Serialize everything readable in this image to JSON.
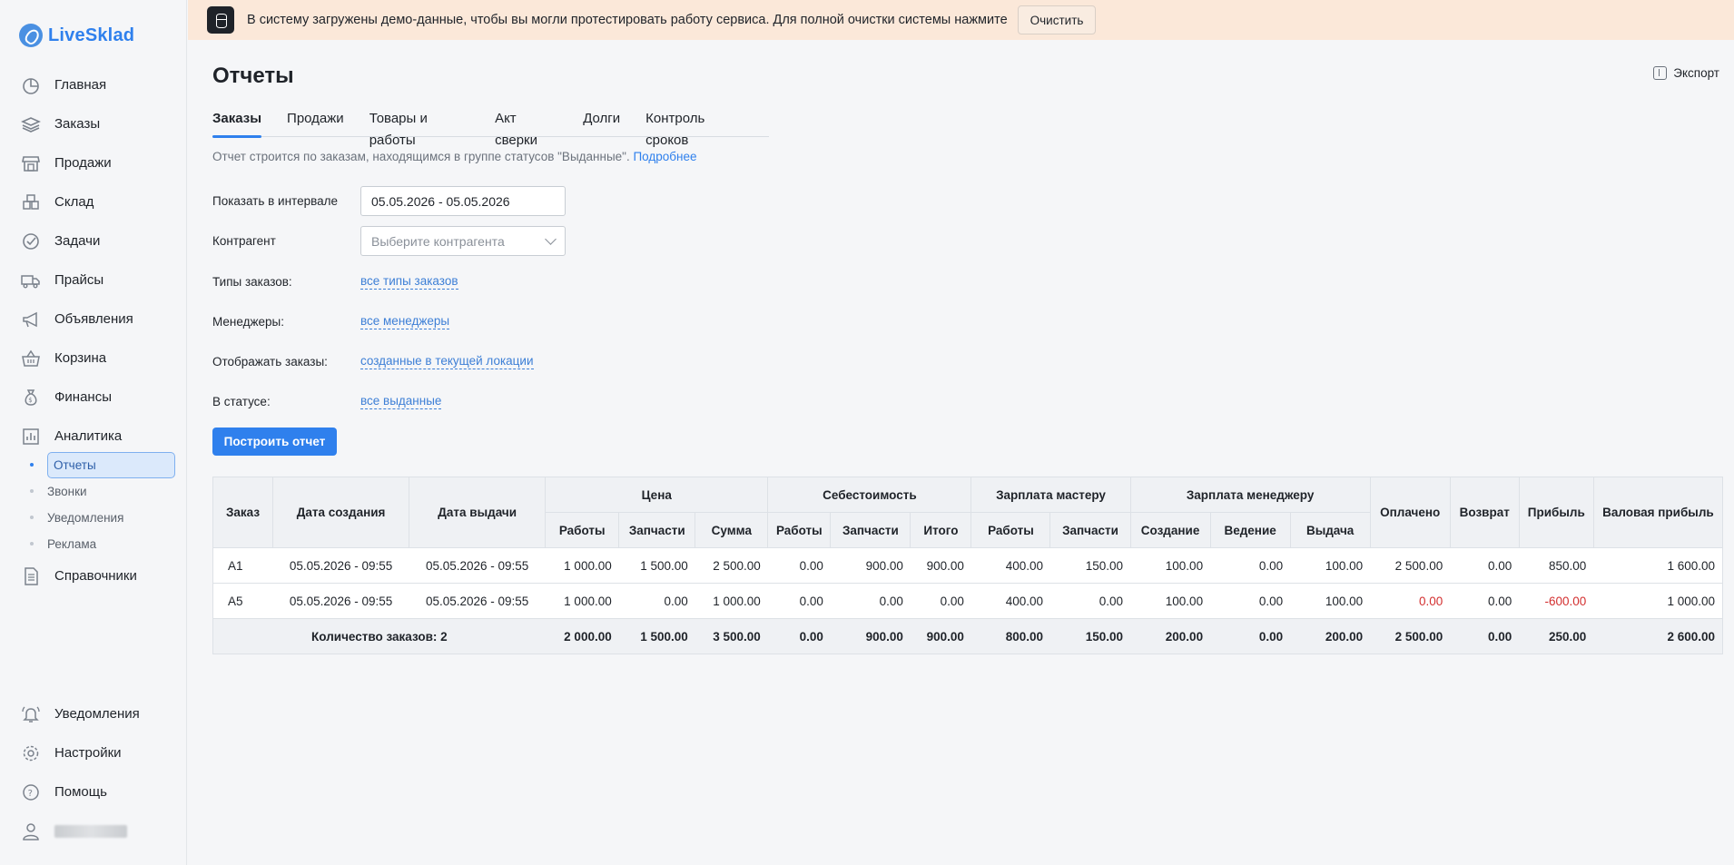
{
  "app": {
    "name": "LiveSklad"
  },
  "sidebar": {
    "items": [
      {
        "label": "Главная",
        "icon": "pie-chart-icon"
      },
      {
        "label": "Заказы",
        "icon": "layers-icon"
      },
      {
        "label": "Продажи",
        "icon": "store-icon"
      },
      {
        "label": "Склад",
        "icon": "boxes-icon"
      },
      {
        "label": "Задачи",
        "icon": "check-circle-icon"
      },
      {
        "label": "Прайсы",
        "icon": "truck-icon"
      },
      {
        "label": "Объявления",
        "icon": "megaphone-icon"
      },
      {
        "label": "Корзина",
        "icon": "basket-icon"
      },
      {
        "label": "Финансы",
        "icon": "money-bag-icon"
      },
      {
        "label": "Аналитика",
        "icon": "bar-chart-icon"
      }
    ],
    "sub_items": [
      {
        "label": "Отчеты",
        "active": true
      },
      {
        "label": "Звонки"
      },
      {
        "label": "Уведомления"
      },
      {
        "label": "Реклама"
      }
    ],
    "reference": {
      "label": "Справочники",
      "icon": "document-icon"
    },
    "bottom": [
      {
        "label": "Уведомления",
        "icon": "bell-icon"
      },
      {
        "label": "Настройки",
        "icon": "gear-icon"
      },
      {
        "label": "Помощь",
        "icon": "help-icon"
      }
    ]
  },
  "banner": {
    "text": "В систему загружены демо-данные, чтобы вы могли протестировать работу сервиса. Для полной очистки системы нажмите",
    "button": "Очистить"
  },
  "page": {
    "title": "Отчеты",
    "export": "Экспорт",
    "tabs": [
      "Заказы",
      "Продажи",
      "Товары и работы",
      "Акт сверки",
      "Долги",
      "Контроль сроков"
    ],
    "note": "Отчет строится по заказам, находящимся в группе статусов \"Выданные\".",
    "note_link": "Подробнее",
    "filters": {
      "interval_label": "Показать в интервале",
      "interval_value": "05.05.2026 - 05.05.2026",
      "counterparty_label": "Контрагент",
      "counterparty_placeholder": "Выберите контрагента",
      "types_label": "Типы заказов:",
      "types_value": "все типы заказов",
      "managers_label": "Менеджеры:",
      "managers_value": "все менеджеры",
      "show_label": "Отображать заказы:",
      "show_value": "созданные в текущей локации",
      "status_label": "В статусе:",
      "status_value": "все выданные"
    },
    "build_button": "Построить отчет"
  },
  "table": {
    "headers": {
      "order": "Заказ",
      "created": "Дата создания",
      "issued": "Дата выдачи",
      "price": "Цена",
      "cost": "Себестоимость",
      "master_pay": "Зарплата мастеру",
      "manager_pay": "Зарплата менеджеру",
      "paid": "Оплачено",
      "refund": "Возврат",
      "profit": "Прибыль",
      "gross": "Валовая прибыль",
      "works": "Работы",
      "parts": "Запчасти",
      "sum": "Сумма",
      "total": "Итого",
      "creation": "Создание",
      "conduct": "Ведение",
      "issue": "Выдача"
    },
    "rows": [
      [
        "A1",
        "05.05.2026 - 09:55",
        "05.05.2026 - 09:55",
        "1 000.00",
        "1 500.00",
        "2 500.00",
        "0.00",
        "900.00",
        "900.00",
        "400.00",
        "150.00",
        "100.00",
        "0.00",
        "100.00",
        "2 500.00",
        "0.00",
        "850.00",
        "1 600.00"
      ],
      [
        "A5",
        "05.05.2026 - 09:55",
        "05.05.2026 - 09:55",
        "1 000.00",
        "0.00",
        "1 000.00",
        "0.00",
        "0.00",
        "0.00",
        "400.00",
        "0.00",
        "100.00",
        "0.00",
        "100.00",
        "0.00",
        "0.00",
        "-600.00",
        "1 000.00"
      ]
    ],
    "negative_cells": [
      [
        1,
        14
      ],
      [
        1,
        16
      ]
    ],
    "totals": [
      "Количество заказов: 2",
      "2 000.00",
      "1 500.00",
      "3 500.00",
      "0.00",
      "900.00",
      "900.00",
      "800.00",
      "150.00",
      "200.00",
      "0.00",
      "200.00",
      "2 500.00",
      "0.00",
      "250.00",
      "2 600.00"
    ]
  },
  "colors": {
    "accent": "#2f80ed",
    "banner": "#fbe8d9",
    "negative": "#d32f2f"
  }
}
